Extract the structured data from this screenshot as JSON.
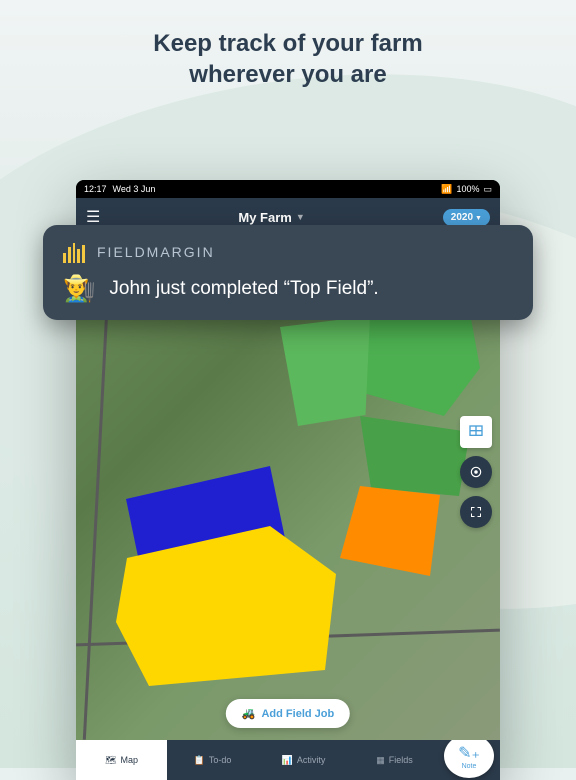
{
  "headline_line1": "Keep track of your farm",
  "headline_line2": "wherever you are",
  "status": {
    "time": "12:17",
    "date": "Wed 3 Jun",
    "wifi": "📶",
    "battery": "100%"
  },
  "header": {
    "farm_name": "My Farm",
    "year": "2020"
  },
  "notification": {
    "app_name": "FIELDMARGIN",
    "emoji": "👨‍🌾",
    "message": "John just completed “Top Field”."
  },
  "map": {
    "add_job_label": "Add Field Job"
  },
  "nav": {
    "items": [
      {
        "label": "Map",
        "icon": "🗺",
        "active": true
      },
      {
        "label": "To-do",
        "icon": "📋",
        "active": false
      },
      {
        "label": "Activity",
        "icon": "📊",
        "active": false
      },
      {
        "label": "Fields",
        "icon": "▦",
        "active": false
      }
    ],
    "note_label": "Note",
    "note_icon": "✎₊"
  },
  "colors": {
    "header_bg": "#2b3a4a",
    "accent": "#4a9fd8",
    "notif_bg": "#3a4856"
  }
}
